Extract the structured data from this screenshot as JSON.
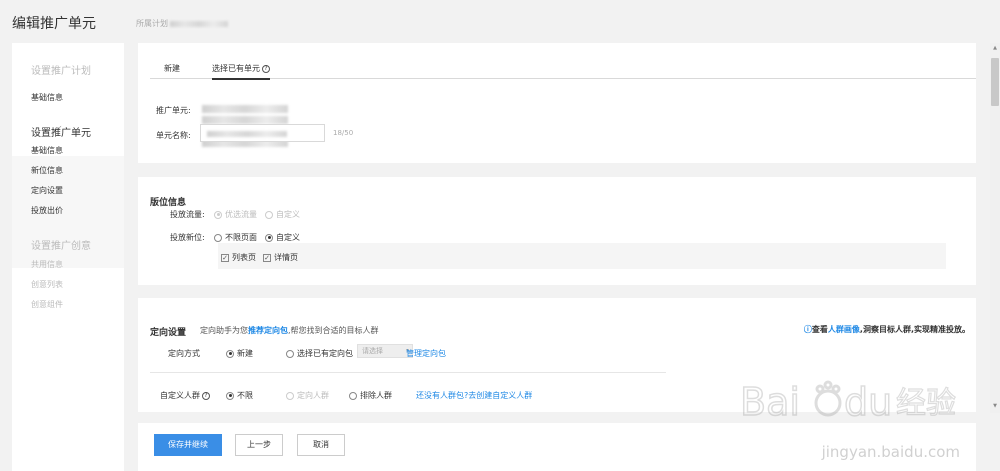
{
  "header": {
    "title": "编辑推广单元",
    "plan_label": "所属计划"
  },
  "sidebar": {
    "steps": [
      {
        "title": "设置推广计划",
        "items": [
          "基础信息"
        ]
      },
      {
        "title": "设置推广单元",
        "items": [
          "基础信息",
          "新位信息",
          "定向设置",
          "投放出价"
        ]
      },
      {
        "title": "设置推广创意",
        "items": [
          "共用信息",
          "创意列表",
          "创意组件"
        ]
      }
    ],
    "check": "✓"
  },
  "unit": {
    "tabs": [
      "新建",
      "选择已有单元"
    ],
    "fields": {
      "unit_label": "推广单元:",
      "name_label": "单元名称:",
      "name_count": "18/50"
    }
  },
  "placement": {
    "title": "版位信息",
    "traffic_label": "投放流量:",
    "traffic_options": [
      "优选流量",
      "自定义"
    ],
    "position_label": "投放新位:",
    "position_options": [
      "不限页面",
      "自定义"
    ],
    "page_options": [
      "列表页",
      "详情页"
    ]
  },
  "targeting": {
    "title": "定向设置",
    "desc_prefix": "定向助手为您",
    "desc_link": "推荐定向包",
    "desc_suffix": ",帮您找到合适的目标人群",
    "insight_prefix": "查看",
    "insight_link": "人群画像",
    "insight_suffix": ",洞察目标人群,实现精准投放。",
    "mode_label": "定向方式",
    "mode_options": [
      "新建",
      "选择已有定向包"
    ],
    "select_placeholder": "请选择",
    "manage_link": "管理定向包",
    "custom_label": "自定义人群",
    "crowd_options": [
      "不限",
      "定向人群",
      "排除人群"
    ],
    "create_link": "还没有人群包?去创建自定义人群"
  },
  "actions": {
    "save": "保存并继续",
    "prev": "上一步",
    "cancel": "取消"
  },
  "watermark": {
    "brand": "Bai du 经验",
    "url": "jingyan.baidu.com"
  }
}
